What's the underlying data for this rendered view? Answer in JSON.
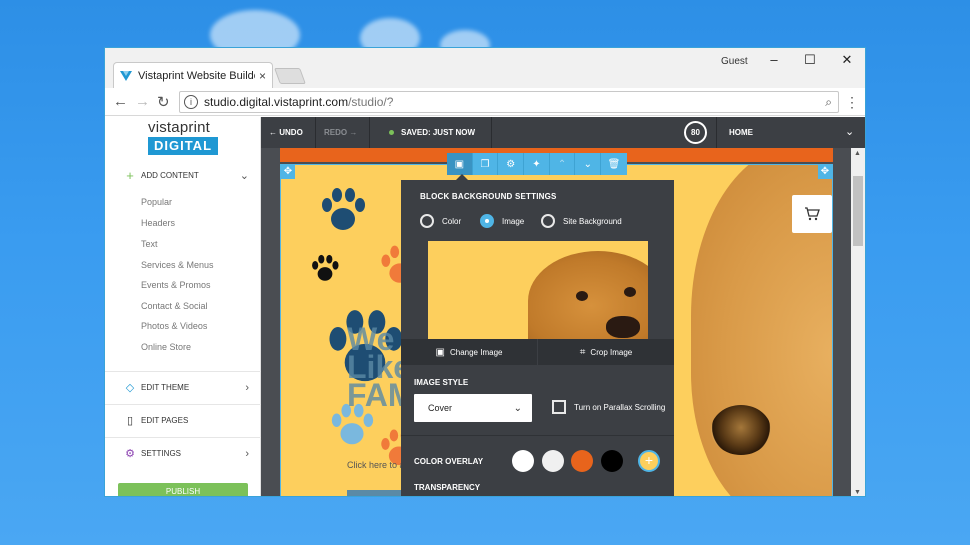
{
  "browser": {
    "tab_title": "Vistaprint Website Builde",
    "tab_close": "×",
    "profile": "Guest",
    "url_host": "studio.digital.vistaprint.com",
    "url_path": "/studio/?",
    "win_minimize": "–",
    "win_maximize": "☐",
    "win_close": "✕",
    "back": "←",
    "forward": "→",
    "reload": "↻",
    "menu": "⋮",
    "zoom": "⌕"
  },
  "sidebar": {
    "logo_top": "vistaprint",
    "logo_bottom": "DIGITAL",
    "add_content": "ADD CONTENT",
    "items": [
      {
        "label": "Popular"
      },
      {
        "label": "Headers"
      },
      {
        "label": "Text"
      },
      {
        "label": "Services & Menus"
      },
      {
        "label": "Events & Promos"
      },
      {
        "label": "Contact & Social"
      },
      {
        "label": "Photos & Videos"
      },
      {
        "label": "Online Store"
      }
    ],
    "edit_theme": "EDIT THEME",
    "edit_pages": "EDIT PAGES",
    "settings": "SETTINGS",
    "publish": "PUBLISH"
  },
  "editor": {
    "undo": "UNDO",
    "redo": "REDO",
    "saved": "SAVED: JUST NOW",
    "score": "80",
    "page": "HOME"
  },
  "site": {
    "headline_line1": "We T",
    "headline_line2": "Like",
    "headline_line3": "FAM",
    "click_text": "Click here to add a"
  },
  "panel": {
    "title": "BLOCK BACKGROUND SETTINGS",
    "options": [
      {
        "label": "Color",
        "selected": false
      },
      {
        "label": "Image",
        "selected": true
      },
      {
        "label": "Site Background",
        "selected": false
      }
    ],
    "change_image": "Change Image",
    "crop_image": "Crop Image",
    "image_style_label": "IMAGE STYLE",
    "image_style_value": "Cover",
    "parallax_label": "Turn on Parallax Scrolling",
    "parallax_checked": false,
    "color_overlay_label": "COLOR OVERLAY",
    "overlay_colors": [
      "#ffffff",
      "#f0f0f0",
      "#e8641c",
      "#000000"
    ],
    "transparency_label": "TRANSPARENCY"
  },
  "colors": {
    "accent": "#4fb5e6",
    "site_bg": "#fdcf5d",
    "brand_orange": "#e8641c",
    "publish_green": "#7cc15a"
  }
}
